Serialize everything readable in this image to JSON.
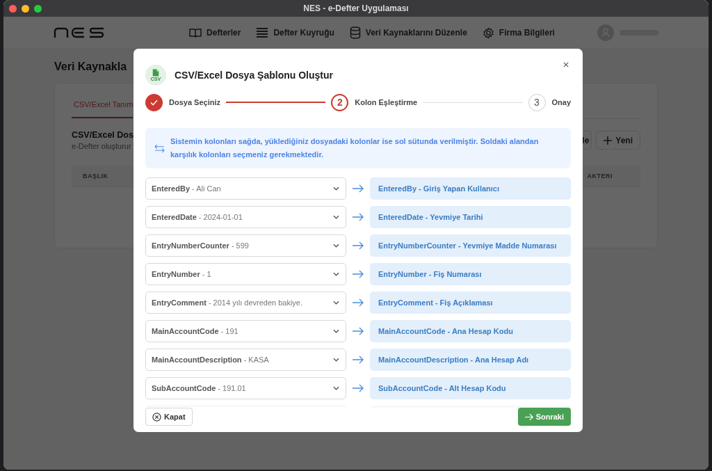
{
  "window": {
    "title": "NES - e-Defter Uygulaması"
  },
  "nav": [
    {
      "label": "Defterler"
    },
    {
      "label": "Defter Kuyruğu"
    },
    {
      "label": "Veri Kaynaklarını Düzenle"
    },
    {
      "label": "Firma Bilgileri"
    }
  ],
  "page": {
    "title": "Veri Kaynakla",
    "tab": "CSV/Excel Tanım",
    "card_title": "CSV/Excel Dos",
    "card_subtitle": "e-Defter oluşturur",
    "column_1": "BAŞLIK",
    "column_2": "AKTERI",
    "button_1": "le",
    "button_2": "Yeni"
  },
  "modal": {
    "title": "CSV/Excel Dosya Şablonu Oluştur",
    "icon_text": "CSV",
    "steps": [
      {
        "label": "Dosya Seçiniz",
        "done": true,
        "selected": false
      },
      {
        "number": "2",
        "label": "Kolon Eşleştirme",
        "done": false,
        "selected": true
      },
      {
        "number": "3",
        "label": "Onay",
        "done": false,
        "selected": false
      }
    ],
    "info": "Sistemin kolonları sağda, yüklediğiniz dosyadaki kolonlar ise sol sütunda verilmiştir. Soldaki alandan karşılık kolonları seçmeniz gerekmektedir.",
    "mappings": [
      {
        "source": "**EnteredBy** - Ali Can",
        "target": "EnteredBy - Giriş Yapan Kullanıcı"
      },
      {
        "source": "**EnteredDate** - 2024-01-01",
        "target": "EnteredDate - Yevmiye Tarihi"
      },
      {
        "source": "**EntryNumberCounter** - 599",
        "target": "EntryNumberCounter - Yevmiye Madde Numarası"
      },
      {
        "source": "**EntryNumber** - 1",
        "target": "EntryNumber - Fiş Numarası"
      },
      {
        "source": "**EntryComment** - 2014 yılı devreden bakiye.",
        "target": "EntryComment - Fiş Açıklaması"
      },
      {
        "source": "**MainAccountCode** - 191",
        "target": "MainAccountCode - Ana Hesap Kodu"
      },
      {
        "source": "**MainAccountDescription** - KASA",
        "target": "MainAccountDescription - Ana Hesap Adı"
      },
      {
        "source": "**SubAccountCode** - 191.01",
        "target": "SubAccountCode - Alt Hesap Kodu"
      }
    ],
    "close_button": "Kapat",
    "next_button": "Sonraki"
  }
}
